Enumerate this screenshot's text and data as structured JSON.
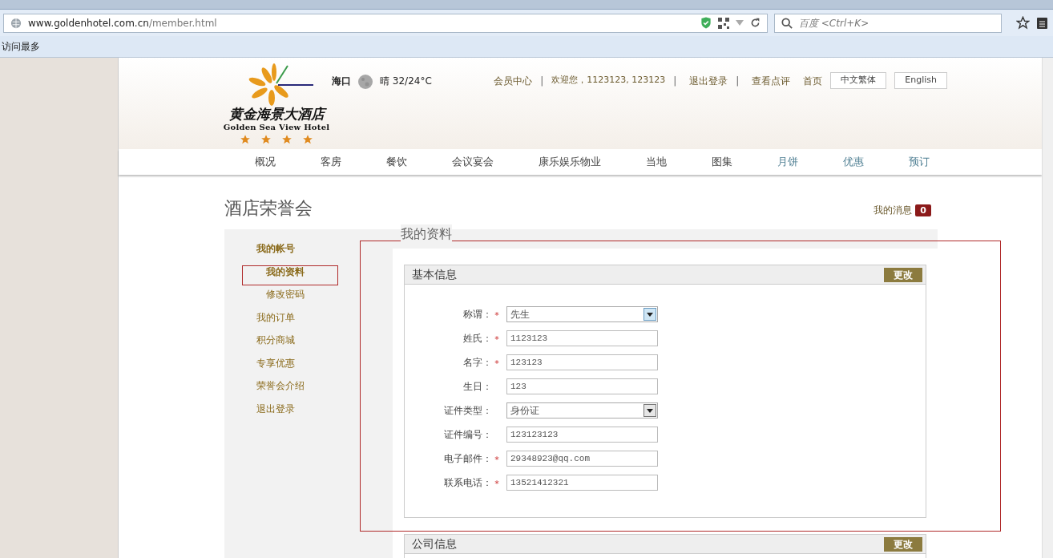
{
  "browser": {
    "url_host": "www.goldenhotel.com.cn",
    "url_path": "/member.html",
    "search_placeholder": "百度 <Ctrl+K>",
    "bookmarks": [
      "访问最多"
    ]
  },
  "header": {
    "logo_cn": "黄金海景大酒店",
    "logo_en": "Golden Sea View Hotel",
    "stars": 4,
    "city": "海口",
    "weather": "晴 32/24°C",
    "links": [
      {
        "kind": "link",
        "text": "会员中心"
      },
      {
        "kind": "separator",
        "text": "|"
      },
      {
        "kind": "text",
        "text": "欢迎您，1123123, 123123"
      },
      {
        "kind": "separator",
        "text": "|"
      },
      {
        "kind": "link",
        "text": "退出登录"
      },
      {
        "kind": "separator",
        "text": "|"
      },
      {
        "kind": "link",
        "text": "查看点评"
      },
      {
        "kind": "link",
        "text": "首页"
      }
    ],
    "languages": [
      "中文繁体",
      "English"
    ]
  },
  "nav": [
    {
      "label": "概况",
      "featured": false
    },
    {
      "label": "客房",
      "featured": false
    },
    {
      "label": "餐饮",
      "featured": false
    },
    {
      "label": "会议宴会",
      "featured": false
    },
    {
      "label": "康乐娱乐物业",
      "featured": false
    },
    {
      "label": "当地",
      "featured": false
    },
    {
      "label": "图集",
      "featured": false
    },
    {
      "label": "月饼",
      "featured": true
    },
    {
      "label": "优惠",
      "featured": true
    },
    {
      "label": "预订",
      "featured": true
    }
  ],
  "page_title": "酒店荣誉会",
  "messages": {
    "label": "我的消息",
    "count": "0"
  },
  "sidebar": [
    {
      "label": "我的帐号",
      "selected": false,
      "children": [
        {
          "label": "我的资料",
          "selected": true
        },
        {
          "label": "修改密码",
          "selected": false
        }
      ]
    },
    {
      "label": "我的订单",
      "selected": false
    },
    {
      "label": "积分商城",
      "selected": false
    },
    {
      "label": "专享优惠",
      "selected": false
    },
    {
      "label": "荣誉会介绍",
      "selected": false
    },
    {
      "label": "退出登录",
      "selected": false
    }
  ],
  "section_title": "我的资料",
  "panels": [
    {
      "title": "基本信息",
      "button": "更改",
      "fields": [
        {
          "label": "称谓：",
          "required_mark": "*",
          "kind": "select",
          "value": "先生",
          "focused": true
        },
        {
          "label": "姓氏：",
          "required_mark": "*",
          "kind": "text",
          "value": "1123123"
        },
        {
          "label": "名字：",
          "required_mark": "*",
          "kind": "text",
          "value": "123123"
        },
        {
          "label": "生日：",
          "kind": "text",
          "value": "123"
        },
        {
          "label": "证件类型：",
          "kind": "select",
          "value": "身份证",
          "focused": false
        },
        {
          "label": "证件编号：",
          "kind": "text",
          "value": "123123123"
        },
        {
          "label": "电子邮件：",
          "required_mark": "*",
          "kind": "text",
          "value": "29348923@qq.com"
        },
        {
          "label": "联系电话：",
          "required_mark": "*",
          "kind": "text",
          "value": "13521412321"
        }
      ]
    },
    {
      "title": "公司信息",
      "button": "更改"
    }
  ]
}
